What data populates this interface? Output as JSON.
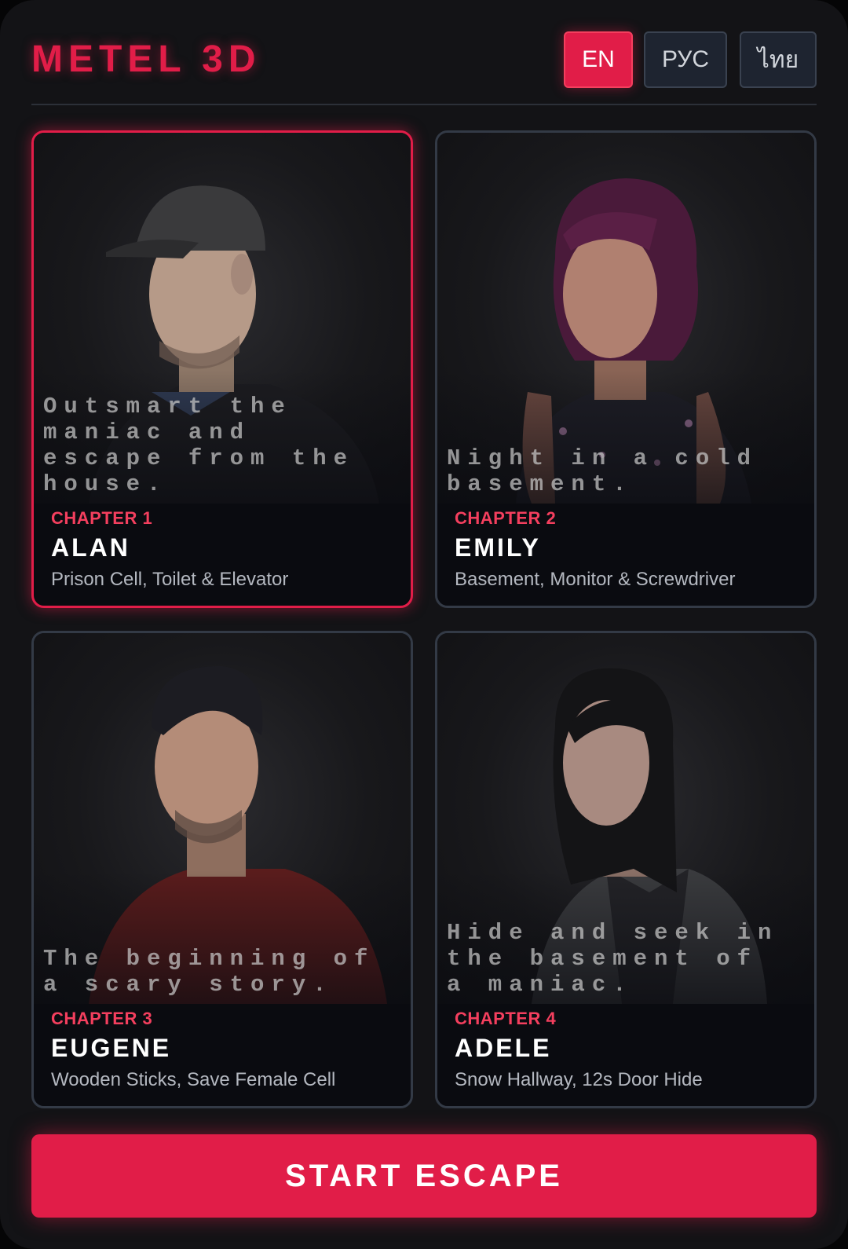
{
  "app": {
    "title": "METEL 3D"
  },
  "languages": [
    {
      "code": "EN",
      "active": true
    },
    {
      "code": "РУС",
      "active": false
    },
    {
      "code": "ไทย",
      "active": false
    }
  ],
  "chapters": [
    {
      "chapter_label": "CHAPTER 1",
      "hero": "ALAN",
      "locations": "Prison Cell, Toilet & Elevator",
      "tagline": "Outsmart the maniac and escape from the house.",
      "selected": true,
      "portrait_icon": "man-in-cap-portrait"
    },
    {
      "chapter_label": "CHAPTER 2",
      "hero": "EMILY",
      "locations": "Basement, Monitor & Screwdriver",
      "tagline": "Night in a cold basement.",
      "selected": false,
      "portrait_icon": "woman-curly-hair-portrait"
    },
    {
      "chapter_label": "CHAPTER 3",
      "hero": "EUGENE",
      "locations": "Wooden Sticks, Save Female Cell",
      "tagline": "The beginning of a scary story.",
      "selected": false,
      "portrait_icon": "man-red-shirt-portrait"
    },
    {
      "chapter_label": "CHAPTER 4",
      "hero": "ADELE",
      "locations": "Snow Hallway, 12s Door Hide",
      "tagline": "Hide and seek in the basement of a maniac.",
      "selected": false,
      "portrait_icon": "woman-dark-hair-portrait"
    }
  ],
  "actions": {
    "start_label": "START ESCAPE"
  },
  "colors": {
    "accent": "#e11d48",
    "background": "#131316",
    "card_border": "#333a46",
    "chapter_text": "#f43f5e"
  }
}
